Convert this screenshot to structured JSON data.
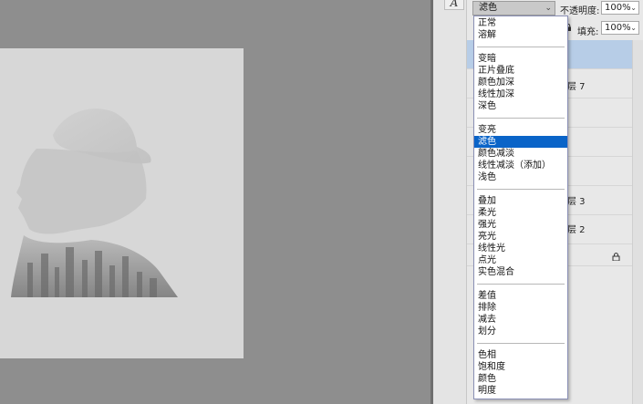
{
  "toolbar": {
    "tool_glyph": "A",
    "tool_icon": "type-tool-icon"
  },
  "options": {
    "blend_mode": "滤色",
    "opacity_label": "不透明度:",
    "opacity_value": "100%",
    "fill_label": "填充:",
    "fill_value": "100%"
  },
  "layers": {
    "items": [
      {
        "name": "",
        "selected": true
      },
      {
        "name": "层 7",
        "selected": false
      },
      {
        "name": "",
        "selected": false
      },
      {
        "name": "",
        "selected": false
      },
      {
        "name": "",
        "selected": false
      },
      {
        "name": "层 3",
        "selected": false
      },
      {
        "name": "层 2",
        "selected": false
      },
      {
        "name": "",
        "selected": false,
        "locked": true
      }
    ]
  },
  "blend_menu": {
    "groups": [
      [
        "正常",
        "溶解"
      ],
      [
        "变暗",
        "正片叠底",
        "颜色加深",
        "线性加深",
        "深色"
      ],
      [
        "变亮",
        "滤色",
        "颜色减淡",
        "线性减淡（添加）",
        "浅色"
      ],
      [
        "叠加",
        "柔光",
        "强光",
        "亮光",
        "线性光",
        "点光",
        "实色混合"
      ],
      [
        "差值",
        "排除",
        "减去",
        "划分"
      ],
      [
        "色相",
        "饱和度",
        "颜色",
        "明度"
      ]
    ],
    "highlighted": "滤色"
  },
  "colors": {
    "highlight": "#0a64c8",
    "selected_layer": "#b7cde7",
    "workspace": "#8e8e8e"
  }
}
